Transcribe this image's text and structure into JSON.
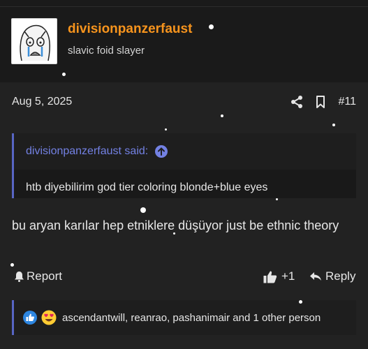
{
  "user": {
    "name": "divisionpanzerfaust",
    "title": "slavic foid slayer"
  },
  "post": {
    "date": "Aug 5, 2025",
    "number": "#11",
    "quote": {
      "author": "divisionpanzerfaust said:",
      "text": "htb diyebilirim god tier coloring blonde+blue eyes"
    },
    "body": "bu aryan karılar hep etniklere düşüyor just be ethnic theory",
    "report_label": "Report",
    "like_count": "+1",
    "reply_label": "Reply",
    "reactions": {
      "icons": [
        "like-icon",
        "heart-eyes-icon"
      ],
      "users": "ascendantwill, reanrao, pashanimair and 1 other person"
    }
  },
  "colors": {
    "accent_username": "#f7941d",
    "quote_accent": "#5865c4",
    "background": "#1a1a1a"
  }
}
